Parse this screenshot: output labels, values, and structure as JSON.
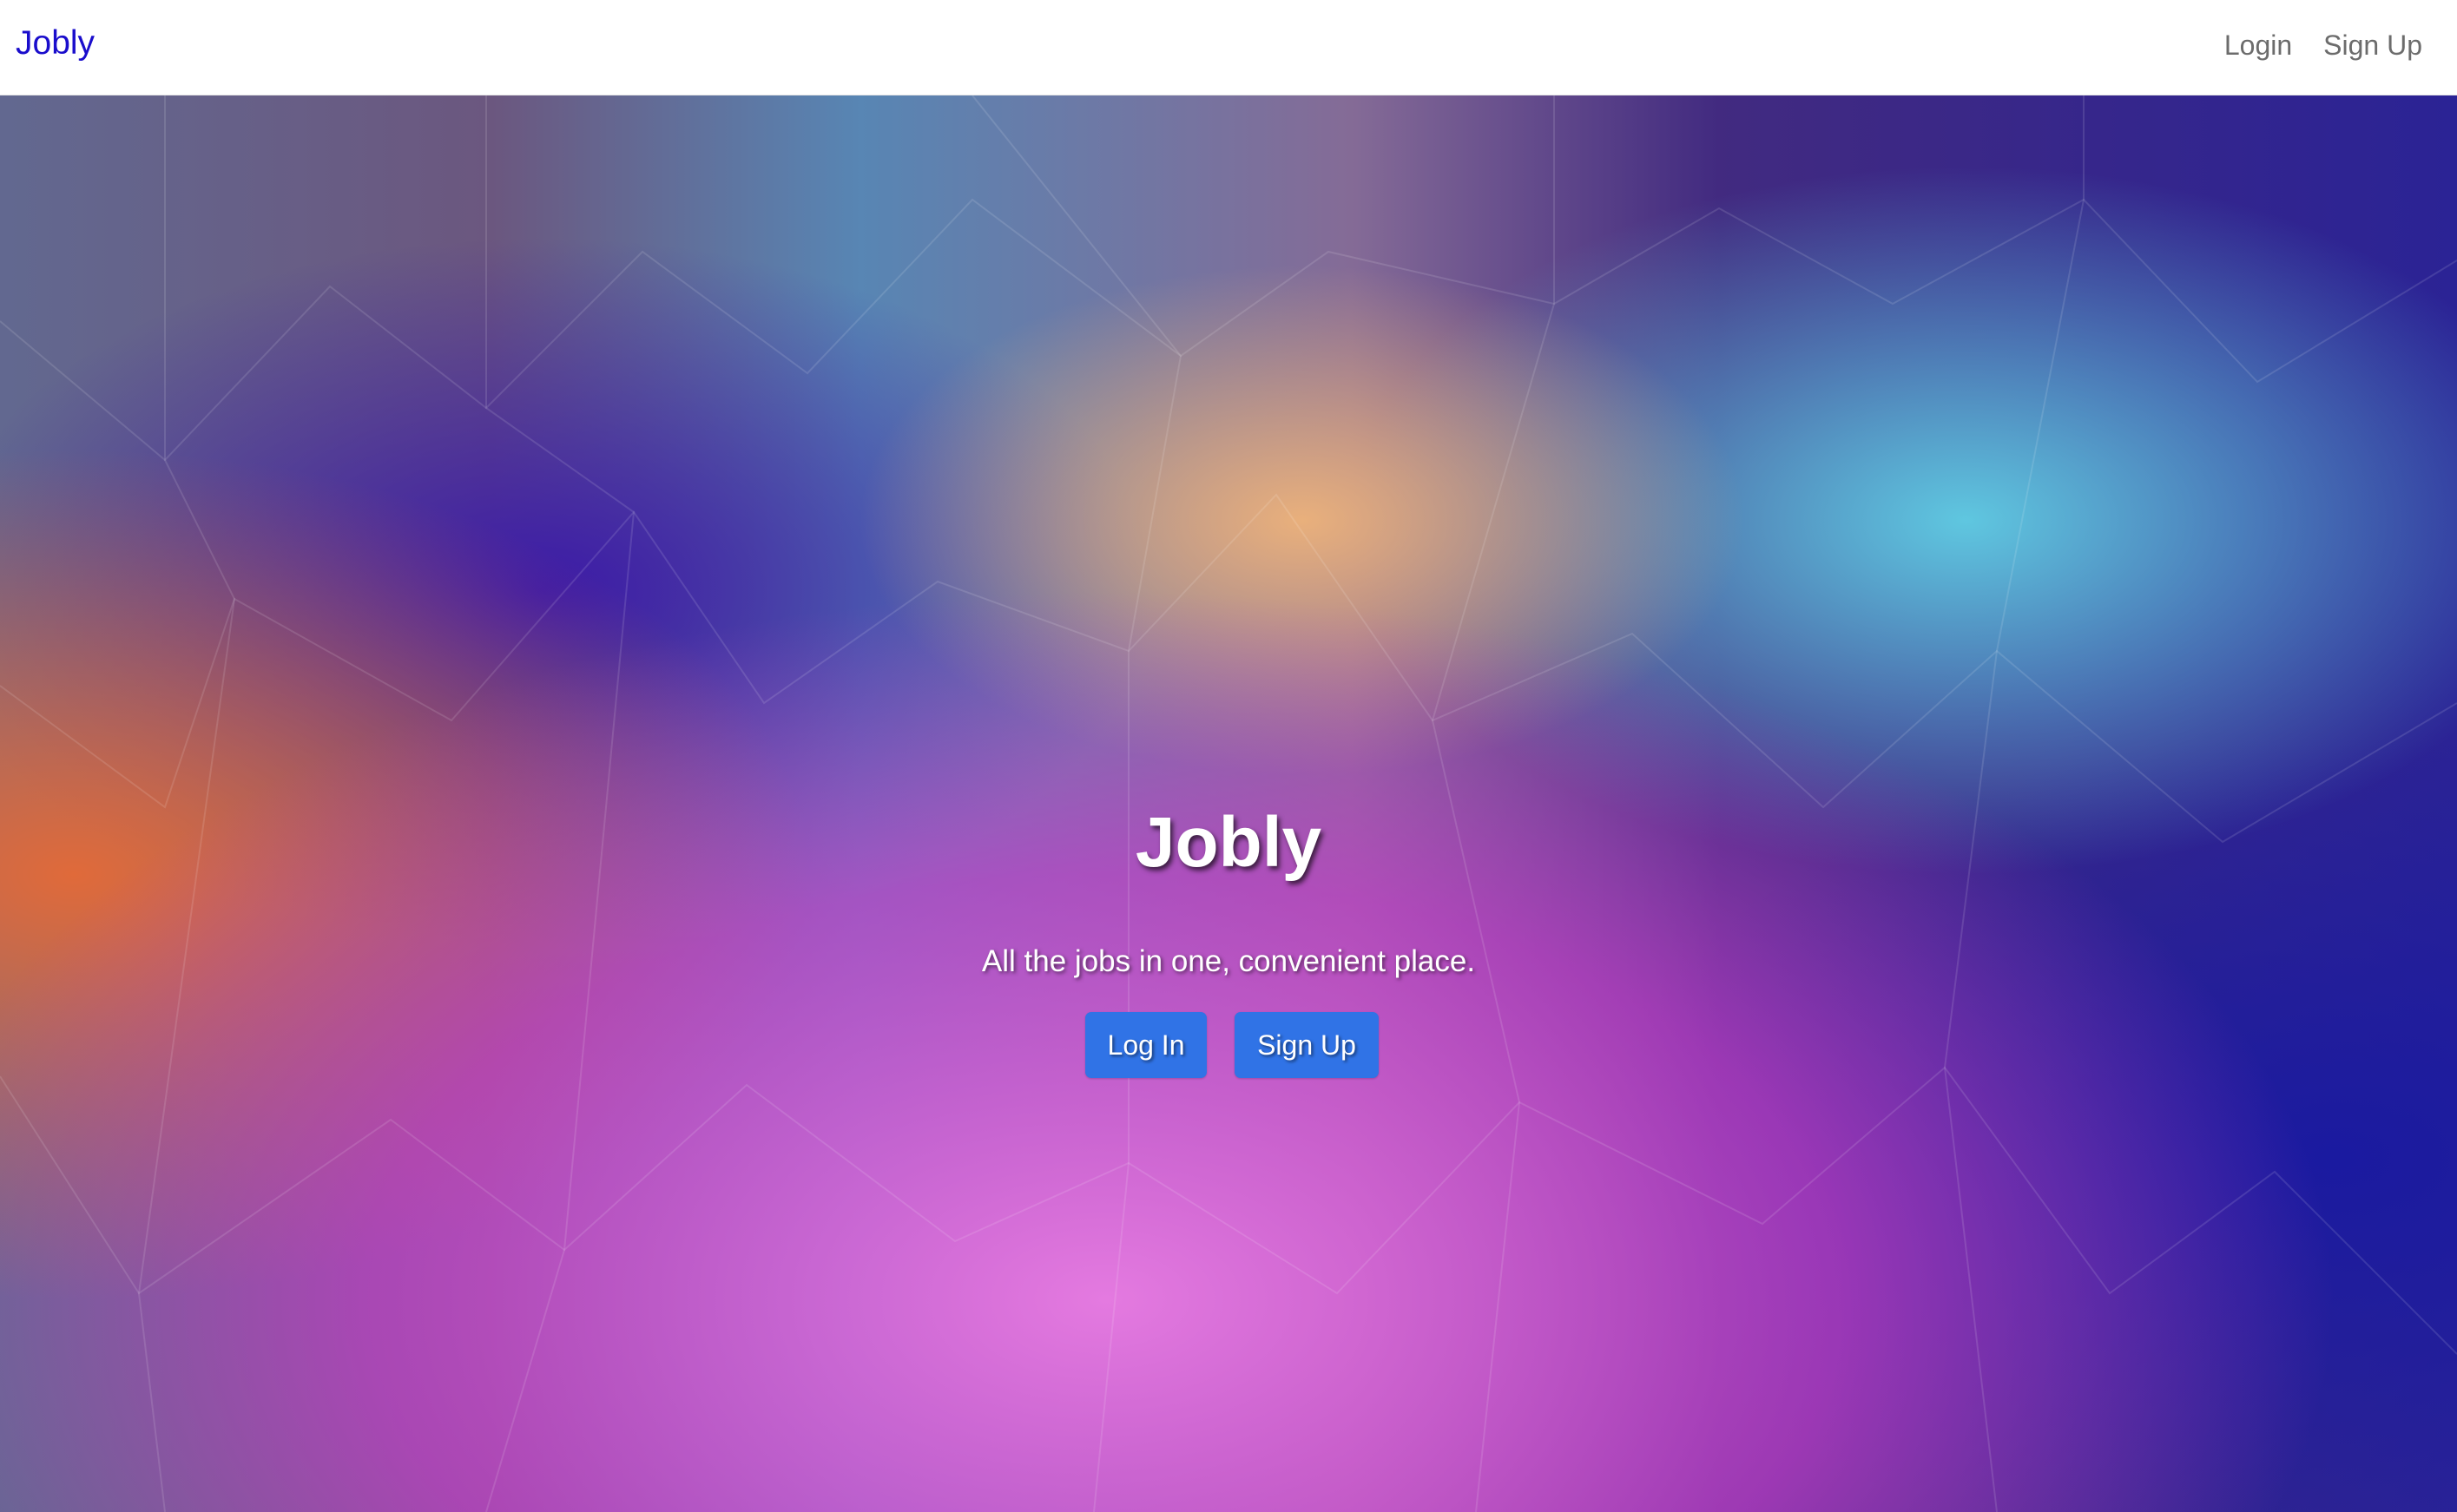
{
  "navbar": {
    "brand": "Jobly",
    "links": [
      {
        "label": "Login"
      },
      {
        "label": "Sign Up"
      }
    ]
  },
  "hero": {
    "title": "Jobly",
    "subtitle": "All the jobs in one, convenient place.",
    "buttons": [
      {
        "label": "Log In"
      },
      {
        "label": "Sign Up"
      }
    ]
  },
  "colors": {
    "brand": "#1a0dcc",
    "nav_link": "#6c6c6c",
    "button": "#3073e6",
    "hero_text": "#ffffff"
  },
  "background": "low-poly-gradient"
}
